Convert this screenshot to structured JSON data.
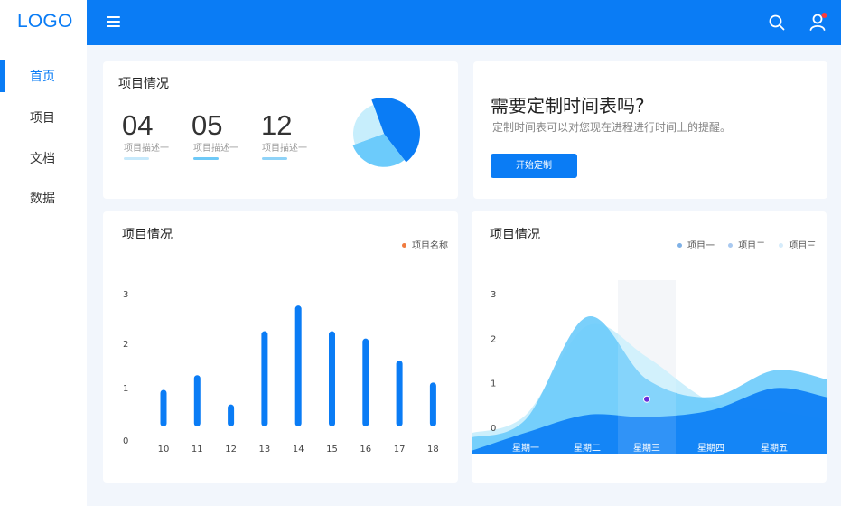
{
  "sidebar": {
    "logo": "LOGO",
    "items": [
      {
        "label": "首页",
        "active": true
      },
      {
        "label": "项目",
        "active": false
      },
      {
        "label": "文档",
        "active": false
      },
      {
        "label": "数据",
        "active": false
      }
    ]
  },
  "header": {
    "icons": [
      "menu-icon",
      "search-icon",
      "user-icon"
    ],
    "notification_color": "#ff3b3b"
  },
  "overview": {
    "title": "项目情况",
    "stats": [
      {
        "value": "04",
        "label": "项目描述一",
        "bar_color": "#c7e9fb"
      },
      {
        "value": "05",
        "label": "项目描述一",
        "bar_color": "#6ec9f7"
      },
      {
        "value": "12",
        "label": "项目描述一",
        "bar_color": "#8fd3f8"
      }
    ]
  },
  "promo": {
    "title": "需要定制时间表吗?",
    "description": "定制时间表可以对您现在进程进行时间上的提醒。",
    "button_label": "开始定制"
  },
  "colors": {
    "accent": "#0a7cf5",
    "light1": "#c7eefc",
    "light2": "#6ccbfb",
    "legend_orange": "#f07b3f"
  },
  "chart_data": [
    {
      "type": "pie",
      "values": [
        45,
        30,
        25
      ],
      "colors": [
        "#0a7cf5",
        "#6ccbfb",
        "#c7eefc"
      ]
    },
    {
      "type": "bar",
      "title": "项目情况",
      "legend": [
        {
          "name": "项目名称",
          "color": "#f07b3f"
        }
      ],
      "categories": [
        "10",
        "11",
        "12",
        "13",
        "14",
        "15",
        "16",
        "17",
        "18"
      ],
      "values": [
        1.0,
        1.4,
        0.6,
        2.6,
        3.3,
        2.6,
        2.4,
        1.8,
        1.2
      ],
      "yticks": [
        "0",
        "1",
        "2",
        "3"
      ],
      "ylim": [
        0,
        3.6
      ],
      "legend_position": "top-right"
    },
    {
      "type": "area",
      "title": "项目情况",
      "legend": [
        {
          "name": "项目一",
          "color": "#7fb1e6"
        },
        {
          "name": "项目二",
          "color": "#a9c9f0"
        },
        {
          "name": "项目三",
          "color": "#d6ecfb"
        }
      ],
      "categories": [
        "星期一",
        "星期二",
        "星期三",
        "星期四",
        "星期五"
      ],
      "yticks": [
        "0",
        "1",
        "2",
        "3"
      ],
      "ylim": [
        -0.4,
        3.4
      ],
      "series": [
        {
          "name": "项目三",
          "color": "#c9eefc",
          "values": [
            0.3,
            2.3,
            1.6,
            0.6,
            0.4
          ]
        },
        {
          "name": "项目二",
          "color": "#6ccbfb",
          "values": [
            0.2,
            2.5,
            1.1,
            0.7,
            1.3
          ]
        },
        {
          "name": "项目一",
          "color": "#0a7cf5",
          "values": [
            -0.1,
            0.3,
            0.25,
            0.4,
            0.9
          ]
        }
      ],
      "highlight_category": "星期三",
      "highlight_point": {
        "category": "星期三",
        "value": 1.1,
        "color": "#6a2bd9"
      },
      "legend_position": "top-right"
    }
  ]
}
